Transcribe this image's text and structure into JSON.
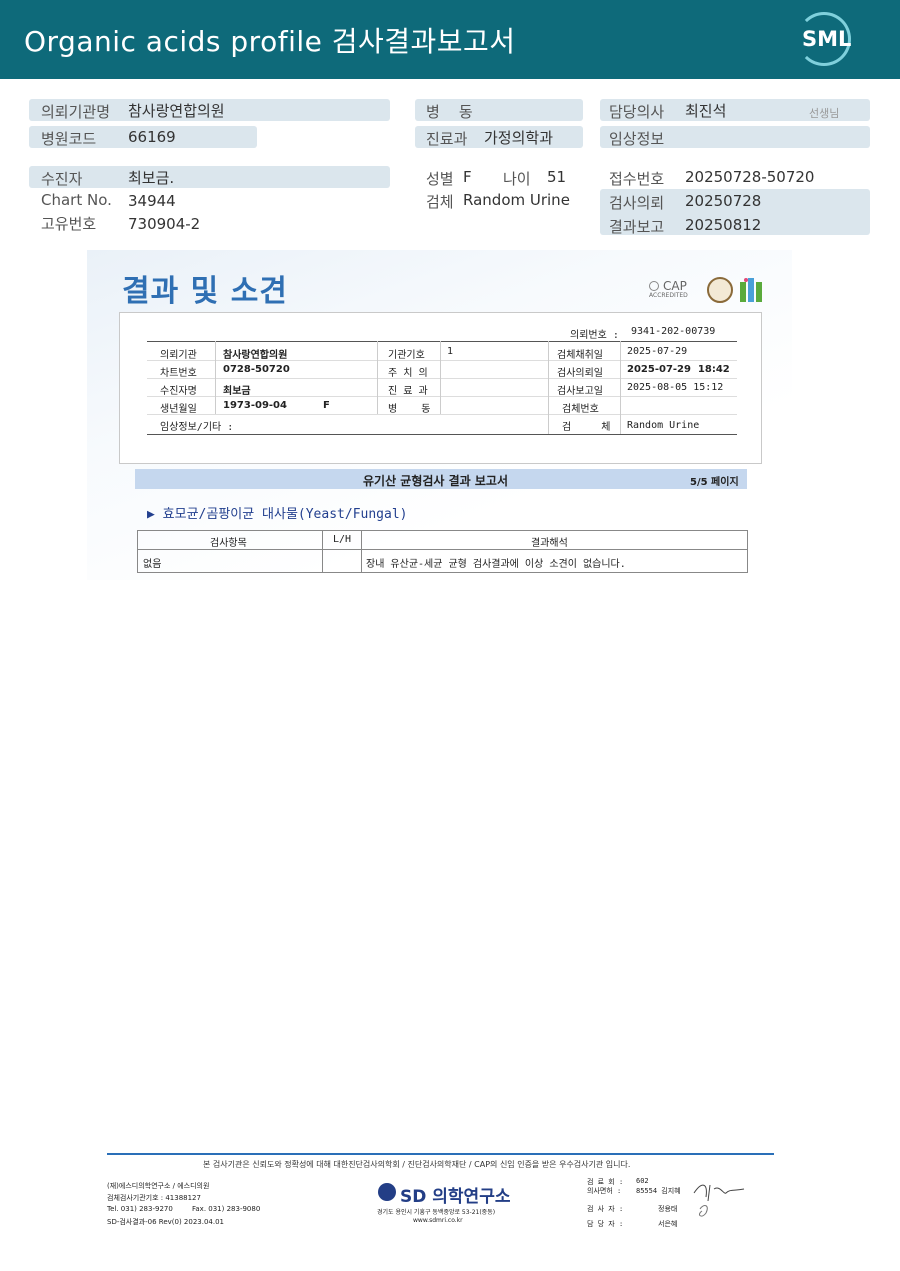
{
  "header": {
    "title": "Organic acids profile 검사결과보고서",
    "logo_text": "SML"
  },
  "patient_info": {
    "hospital_label": "의뢰기관명",
    "hospital": "참사랑연합의원",
    "hospital_code_label": "병원코드",
    "hospital_code": "66169",
    "patient_label": "수진자",
    "patient": "최보금.",
    "chart_label": "Chart No.",
    "chart": "34944",
    "id_label": "고유번호",
    "id": "730904-2",
    "ward_label": "병    동",
    "ward": "",
    "dept_label": "진료과",
    "dept": "가정의학과",
    "sex_label": "성별",
    "sex": "F",
    "age_label": "나이",
    "age": "51",
    "specimen_label": "검체",
    "specimen": "Random Urine",
    "doctor_label": "담당의사",
    "doctor": "최진석",
    "doctor_suffix": "선생님",
    "clinical_label": "임상정보",
    "clinical": "",
    "reception_label": "접수번호",
    "reception": "20250728-50720",
    "request_label": "검사의뢰",
    "request": "20250728",
    "report_label": "결과보고",
    "report": "20250812"
  },
  "report": {
    "title": "결과 및 소견",
    "cert_cap": "CAP",
    "cert_cap_sub": "ACCREDITED",
    "request_no_label": "의뢰번호 :",
    "request_no": "9341-202-00739",
    "rows": [
      {
        "l1": "의뢰기관",
        "v1": "참사랑연합의원",
        "l2": "기관기호",
        "v2": "1",
        "l3": "검체채취일",
        "v3": "2025-07-29"
      },
      {
        "l1": "차트번호",
        "v1": "0728-50720",
        "l2": "주 치 의",
        "v2": "",
        "l3": "검사의뢰일",
        "v3": "2025-07-29  18:42"
      },
      {
        "l1": "수진자명",
        "v1": "최보금",
        "l2": "진 료 과",
        "v2": "",
        "l3": "검사보고일",
        "v3": "2025-08-05 15:12"
      },
      {
        "l1": "생년월일",
        "v1": "1973-09-04",
        "v1b": "F",
        "l2": "병    동",
        "v2": "",
        "l3": "검체번호",
        "v3": ""
      }
    ],
    "clinical_label": "임상정보/기타 :",
    "specimen_label": "검     체",
    "specimen": "Random Urine",
    "subtitle": "유기산 균형검사 결과 보고서",
    "page": "5/5 페이지",
    "section": "▶ 효모균/곰팡이균 대사물(Yeast/Fungal)",
    "table_headers": [
      "검사항목",
      "L/H",
      "결과해석"
    ],
    "table_rows": [
      {
        "item": "없음",
        "lh": "",
        "interpretation": "장내 유산균-세균 균형 검사결과에 이상 소견이 없습니다."
      }
    ]
  },
  "footer": {
    "notice": "본 검사기관은 신뢰도와 정확성에 대해 대한진단검사의학회 / 진단검사의학재단 / CAP의 신임 인증을 받은 우수검사기관 입니다.",
    "org1": "(재)에스디의학연구소 / 에스디의원",
    "org2": "검체검사기관기호 : 41388127",
    "tel": "Tel. 031) 283-9270",
    "fax": "Fax. 031) 283-9080",
    "form": "SD-검사결과-06 Rev(0) 2023.04.01",
    "brand": "SD 의학연구소",
    "address": "경기도 용인시 기흥구 동백중앙로 53-21(중동)",
    "web": "www.sdmri.co.kr",
    "license_label": "검 료 회 :",
    "license": "602",
    "doctor_label": "의사면허 :",
    "doctor": "85554 김지혜",
    "tester_label": "검 사 자 :",
    "tester": "정용태",
    "manager_label": "담 당 자 :",
    "manager": "서은혜"
  }
}
